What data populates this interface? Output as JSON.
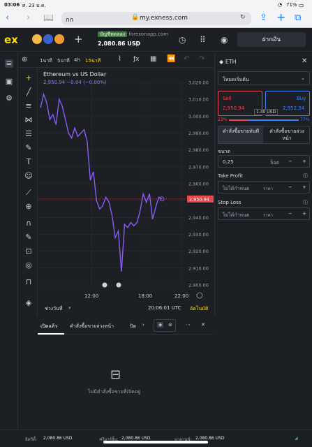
{
  "ios": {
    "time": "03:06",
    "date": "ศ. 23 ม.ค.",
    "wifi": "wifi-icon",
    "battery": "71%"
  },
  "safari": {
    "tab_text": "กก",
    "url": "my.exness.com",
    "lock_icon": "lock-icon"
  },
  "header": {
    "logo": "ex",
    "account_type": "บัญชีทดลอง",
    "server": "forexonapp.com",
    "balance": "2,080.86 USD",
    "deposit_label": "ฝากเงิน",
    "add_label": "+"
  },
  "chart_toolbar": {
    "tf_1m": "1นาที",
    "tf_5m": "5นาที",
    "tf_4h": "4h",
    "tf_15m": "15นาที"
  },
  "chart": {
    "title": "Ethereum vs US Dollar",
    "ohlc": "2,950.94  −0.04 (−0.00%)",
    "current_price": "2,950.94",
    "x_labels": [
      "12:00",
      "18:00",
      "22:00"
    ],
    "period_label": "ช่วงวันที่",
    "clock": "20:06:01 UTC",
    "auto_label": "อัตโนมัติ"
  },
  "chart_data": {
    "type": "line",
    "title": "Ethereum vs US Dollar",
    "xlabel": "",
    "ylabel": "",
    "ylim": [
      2900,
      3020
    ],
    "y_ticks": [
      2900,
      2910,
      2920,
      2930,
      2940,
      2950,
      2960,
      2970,
      2980,
      2990,
      3000,
      3010,
      3020
    ],
    "series": [
      {
        "values": [
          3005,
          3013,
          3008,
          2998,
          3001,
          2995,
          3010,
          3006,
          2998,
          2990,
          2987,
          2993,
          2988,
          2990,
          2992,
          2985,
          2962,
          2967,
          2950,
          2945,
          2947,
          2952,
          2949,
          2941,
          2928,
          2932,
          2908,
          2936,
          2934,
          2937,
          2935,
          2937,
          2944,
          2954,
          2949,
          2954,
          2939,
          2946,
          2952,
          2950.94
        ]
      }
    ],
    "current": 2950.94,
    "grid": true
  },
  "trade_panel": {
    "symbol": "ETH",
    "order_type": "โหมดเริ่มต้น",
    "sell_label": "Sell",
    "sell_price": "2,950.94",
    "buy_label": "Buy",
    "buy_price": "2,952.34",
    "spread": "1.40 USD",
    "sell_pct": "23%",
    "buy_pct": "77%",
    "tab_market": "คำสั่งซื้อขายทันที",
    "tab_pending": "คำสั่งซื้อขายล่วงหน้า",
    "volume_label": "ขนาด",
    "volume_value": "0.25",
    "volume_unit": "ล็อต",
    "tp_label": "Take Profit",
    "tp_value": "ไม่ได้กำหนด",
    "tp_unit": "ราคา",
    "sl_label": "Stop Loss",
    "sl_value": "ไม่ได้กำหนด",
    "sl_unit": "ราคา"
  },
  "orders": {
    "tab_open": "เปิดแล้ว",
    "tab_pending": "คำสั่งซื้อขายล่วงหน้า",
    "tab_closed": "ปิด",
    "empty_text": "ไม่มีคำสั่งซื้อขายที่เปิดอยู่"
  },
  "footer": {
    "equity_label": "อิควิตี้:",
    "equity": "2,080.86 USD",
    "margin_label": "ฟรีมาร์จิ้น:",
    "margin": "2,080.86 USD",
    "balance_label": "บาลานซ์:",
    "balance": "2,080.86 USD"
  },
  "colors": {
    "accent": "#ffdd00",
    "sell": "#e5484d",
    "buy": "#3b82f6",
    "line": "#8b5cf6"
  }
}
